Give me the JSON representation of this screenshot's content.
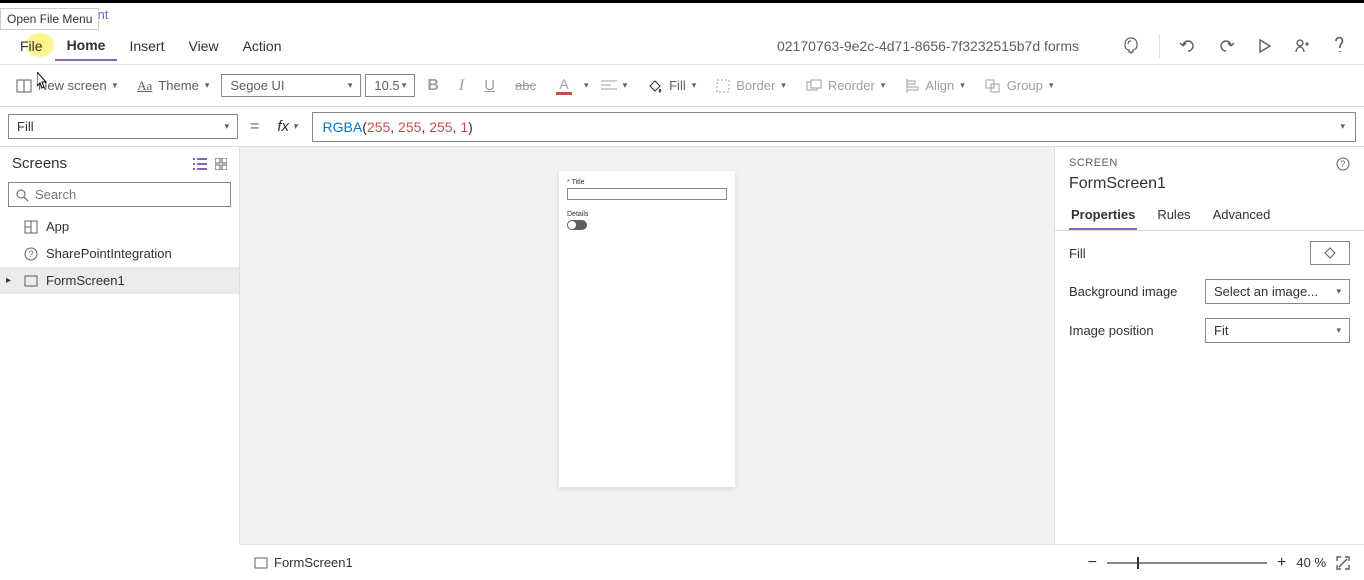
{
  "tooltip": "Open File Menu",
  "breadcrumb": {
    "app": "arePoint"
  },
  "menu": {
    "file": "File",
    "home": "Home",
    "insert": "Insert",
    "view": "View",
    "action": "Action"
  },
  "app_title": "02170763-9e2c-4d71-8656-7f3232515b7d forms",
  "ribbon": {
    "new_screen": "New screen",
    "theme": "Theme",
    "font": "Segoe UI",
    "font_size": "10.5",
    "fill": "Fill",
    "border": "Border",
    "reorder": "Reorder",
    "align": "Align",
    "group": "Group"
  },
  "formula": {
    "property": "Fill",
    "fn": "RGBA",
    "args": [
      "255",
      "255",
      "255",
      "1"
    ]
  },
  "left": {
    "title": "Screens",
    "search_ph": "Search",
    "items": [
      "App",
      "SharePointIntegration",
      "FormScreen1"
    ]
  },
  "canvas": {
    "title_label": "Title",
    "details_label": "Details"
  },
  "right": {
    "header": "SCREEN",
    "name": "FormScreen1",
    "tabs": [
      "Properties",
      "Rules",
      "Advanced"
    ],
    "fill_label": "Fill",
    "bg_label": "Background image",
    "bg_value": "Select an image...",
    "pos_label": "Image position",
    "pos_value": "Fit"
  },
  "status": {
    "screen": "FormScreen1",
    "zoom": "40",
    "zoom_unit": "%"
  }
}
